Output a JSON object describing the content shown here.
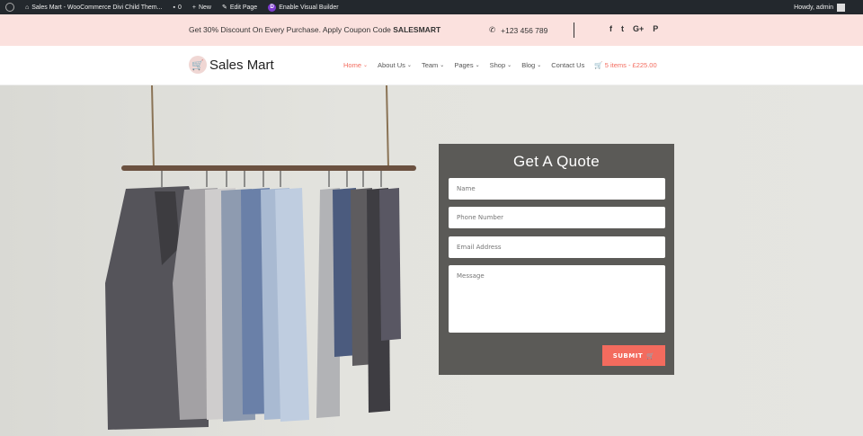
{
  "adminbar": {
    "site": "Sales Mart - WooCommerce Divi Child Them...",
    "comments": "0",
    "new": "New",
    "edit": "Edit Page",
    "builder": "Enable Visual Builder",
    "howdy": "Howdy, admin"
  },
  "promo": {
    "message": "Get 30% Discount On Every Purchase. Apply Coupon Code ",
    "code": "SALESMART",
    "phone": "+123 456 789",
    "social": [
      "f",
      "t",
      "G+",
      "P"
    ]
  },
  "header": {
    "logo": "Sales Mart",
    "nav": [
      {
        "label": "Home",
        "dropdown": true
      },
      {
        "label": "About Us",
        "dropdown": true
      },
      {
        "label": "Team",
        "dropdown": true
      },
      {
        "label": "Pages",
        "dropdown": true
      },
      {
        "label": "Shop",
        "dropdown": true
      },
      {
        "label": "Blog",
        "dropdown": true
      },
      {
        "label": "Contact Us",
        "dropdown": false
      }
    ],
    "cart": "5 items - £225.00"
  },
  "quote": {
    "title": "Get A Quote",
    "name_placeholder": "Name",
    "phone_placeholder": "Phone Number",
    "email_placeholder": "Email Address",
    "message_placeholder": "Message",
    "submit": "SUBMIT"
  },
  "colors": {
    "accent": "#f36b5e",
    "promo_bg": "#fbe1de",
    "form_bg": "#5b5a57",
    "adminbar_bg": "#23282d"
  }
}
